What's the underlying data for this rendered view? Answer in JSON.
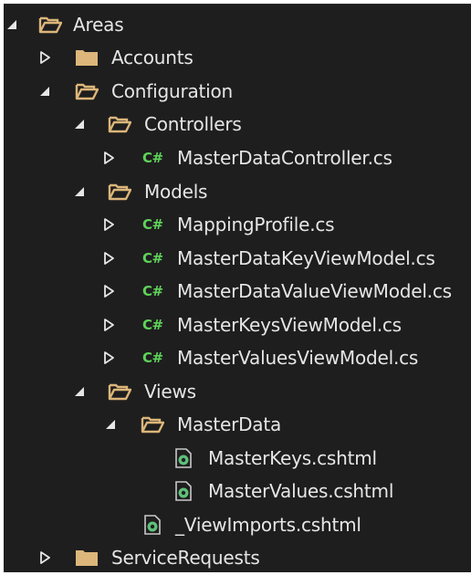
{
  "tree": {
    "icons": {
      "folder_color": "#dcb67a",
      "csharp_badge_color": "#5fd35a",
      "csharp_badge": "C#"
    },
    "items": [
      {
        "label": "Areas",
        "kind": "folder",
        "state": "expanded",
        "depth": 0
      },
      {
        "label": "Accounts",
        "kind": "folder",
        "state": "collapsed",
        "depth": 1
      },
      {
        "label": "Configuration",
        "kind": "folder",
        "state": "expanded",
        "depth": 1
      },
      {
        "label": "Controllers",
        "kind": "folder",
        "state": "expanded",
        "depth": 2
      },
      {
        "label": "MasterDataController.cs",
        "kind": "csharp",
        "state": "collapsed",
        "depth": 3
      },
      {
        "label": "Models",
        "kind": "folder",
        "state": "expanded",
        "depth": 2
      },
      {
        "label": "MappingProfile.cs",
        "kind": "csharp",
        "state": "collapsed",
        "depth": 3
      },
      {
        "label": "MasterDataKeyViewModel.cs",
        "kind": "csharp",
        "state": "collapsed",
        "depth": 3
      },
      {
        "label": "MasterDataValueViewModel.cs",
        "kind": "csharp",
        "state": "collapsed",
        "depth": 3
      },
      {
        "label": "MasterKeysViewModel.cs",
        "kind": "csharp",
        "state": "collapsed",
        "depth": 3
      },
      {
        "label": "MasterValuesViewModel.cs",
        "kind": "csharp",
        "state": "collapsed",
        "depth": 3
      },
      {
        "label": "Views",
        "kind": "folder",
        "state": "expanded",
        "depth": 2
      },
      {
        "label": "MasterData",
        "kind": "folder",
        "state": "expanded",
        "depth": 3
      },
      {
        "label": "MasterKeys.cshtml",
        "kind": "razor",
        "state": "none",
        "depth": 4
      },
      {
        "label": "MasterValues.cshtml",
        "kind": "razor",
        "state": "none",
        "depth": 4
      },
      {
        "label": "_ViewImports.cshtml",
        "kind": "razor",
        "state": "none",
        "depth": 3
      },
      {
        "label": "ServiceRequests",
        "kind": "folder",
        "state": "collapsed",
        "depth": 1
      }
    ]
  }
}
